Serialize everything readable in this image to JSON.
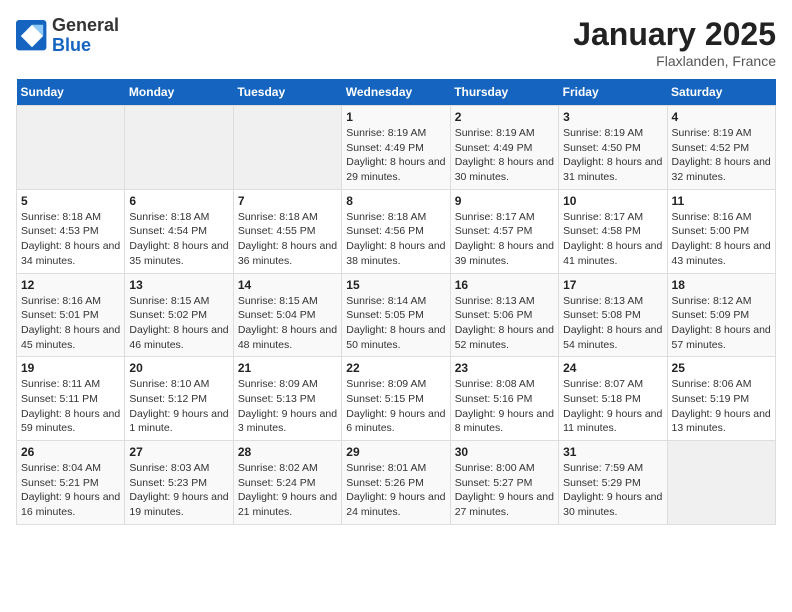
{
  "header": {
    "logo_general": "General",
    "logo_blue": "Blue",
    "title": "January 2025",
    "subtitle": "Flaxlanden, France"
  },
  "weekdays": [
    "Sunday",
    "Monday",
    "Tuesday",
    "Wednesday",
    "Thursday",
    "Friday",
    "Saturday"
  ],
  "weeks": [
    [
      {
        "day": "",
        "info": ""
      },
      {
        "day": "",
        "info": ""
      },
      {
        "day": "",
        "info": ""
      },
      {
        "day": "1",
        "info": "Sunrise: 8:19 AM\nSunset: 4:49 PM\nDaylight: 8 hours and 29 minutes."
      },
      {
        "day": "2",
        "info": "Sunrise: 8:19 AM\nSunset: 4:49 PM\nDaylight: 8 hours and 30 minutes."
      },
      {
        "day": "3",
        "info": "Sunrise: 8:19 AM\nSunset: 4:50 PM\nDaylight: 8 hours and 31 minutes."
      },
      {
        "day": "4",
        "info": "Sunrise: 8:19 AM\nSunset: 4:52 PM\nDaylight: 8 hours and 32 minutes."
      }
    ],
    [
      {
        "day": "5",
        "info": "Sunrise: 8:18 AM\nSunset: 4:53 PM\nDaylight: 8 hours and 34 minutes."
      },
      {
        "day": "6",
        "info": "Sunrise: 8:18 AM\nSunset: 4:54 PM\nDaylight: 8 hours and 35 minutes."
      },
      {
        "day": "7",
        "info": "Sunrise: 8:18 AM\nSunset: 4:55 PM\nDaylight: 8 hours and 36 minutes."
      },
      {
        "day": "8",
        "info": "Sunrise: 8:18 AM\nSunset: 4:56 PM\nDaylight: 8 hours and 38 minutes."
      },
      {
        "day": "9",
        "info": "Sunrise: 8:17 AM\nSunset: 4:57 PM\nDaylight: 8 hours and 39 minutes."
      },
      {
        "day": "10",
        "info": "Sunrise: 8:17 AM\nSunset: 4:58 PM\nDaylight: 8 hours and 41 minutes."
      },
      {
        "day": "11",
        "info": "Sunrise: 8:16 AM\nSunset: 5:00 PM\nDaylight: 8 hours and 43 minutes."
      }
    ],
    [
      {
        "day": "12",
        "info": "Sunrise: 8:16 AM\nSunset: 5:01 PM\nDaylight: 8 hours and 45 minutes."
      },
      {
        "day": "13",
        "info": "Sunrise: 8:15 AM\nSunset: 5:02 PM\nDaylight: 8 hours and 46 minutes."
      },
      {
        "day": "14",
        "info": "Sunrise: 8:15 AM\nSunset: 5:04 PM\nDaylight: 8 hours and 48 minutes."
      },
      {
        "day": "15",
        "info": "Sunrise: 8:14 AM\nSunset: 5:05 PM\nDaylight: 8 hours and 50 minutes."
      },
      {
        "day": "16",
        "info": "Sunrise: 8:13 AM\nSunset: 5:06 PM\nDaylight: 8 hours and 52 minutes."
      },
      {
        "day": "17",
        "info": "Sunrise: 8:13 AM\nSunset: 5:08 PM\nDaylight: 8 hours and 54 minutes."
      },
      {
        "day": "18",
        "info": "Sunrise: 8:12 AM\nSunset: 5:09 PM\nDaylight: 8 hours and 57 minutes."
      }
    ],
    [
      {
        "day": "19",
        "info": "Sunrise: 8:11 AM\nSunset: 5:11 PM\nDaylight: 8 hours and 59 minutes."
      },
      {
        "day": "20",
        "info": "Sunrise: 8:10 AM\nSunset: 5:12 PM\nDaylight: 9 hours and 1 minute."
      },
      {
        "day": "21",
        "info": "Sunrise: 8:09 AM\nSunset: 5:13 PM\nDaylight: 9 hours and 3 minutes."
      },
      {
        "day": "22",
        "info": "Sunrise: 8:09 AM\nSunset: 5:15 PM\nDaylight: 9 hours and 6 minutes."
      },
      {
        "day": "23",
        "info": "Sunrise: 8:08 AM\nSunset: 5:16 PM\nDaylight: 9 hours and 8 minutes."
      },
      {
        "day": "24",
        "info": "Sunrise: 8:07 AM\nSunset: 5:18 PM\nDaylight: 9 hours and 11 minutes."
      },
      {
        "day": "25",
        "info": "Sunrise: 8:06 AM\nSunset: 5:19 PM\nDaylight: 9 hours and 13 minutes."
      }
    ],
    [
      {
        "day": "26",
        "info": "Sunrise: 8:04 AM\nSunset: 5:21 PM\nDaylight: 9 hours and 16 minutes."
      },
      {
        "day": "27",
        "info": "Sunrise: 8:03 AM\nSunset: 5:23 PM\nDaylight: 9 hours and 19 minutes."
      },
      {
        "day": "28",
        "info": "Sunrise: 8:02 AM\nSunset: 5:24 PM\nDaylight: 9 hours and 21 minutes."
      },
      {
        "day": "29",
        "info": "Sunrise: 8:01 AM\nSunset: 5:26 PM\nDaylight: 9 hours and 24 minutes."
      },
      {
        "day": "30",
        "info": "Sunrise: 8:00 AM\nSunset: 5:27 PM\nDaylight: 9 hours and 27 minutes."
      },
      {
        "day": "31",
        "info": "Sunrise: 7:59 AM\nSunset: 5:29 PM\nDaylight: 9 hours and 30 minutes."
      },
      {
        "day": "",
        "info": ""
      }
    ]
  ]
}
